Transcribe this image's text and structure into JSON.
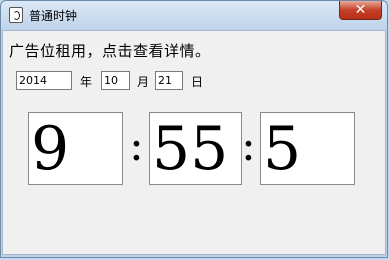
{
  "window": {
    "title": "普通时钟",
    "close_glyph": "✕"
  },
  "ad_text": "广告位租用，点击查看详情。",
  "date": {
    "year": "2014",
    "year_label": "年",
    "month": "10",
    "month_label": "月",
    "day": "21",
    "day_label": "日"
  },
  "clock": {
    "hours": "9",
    "minutes": "55",
    "seconds": "5",
    "separator": ":"
  },
  "colors": {
    "client_bg": "#f0f0f0",
    "close_button": "#c4412b"
  }
}
